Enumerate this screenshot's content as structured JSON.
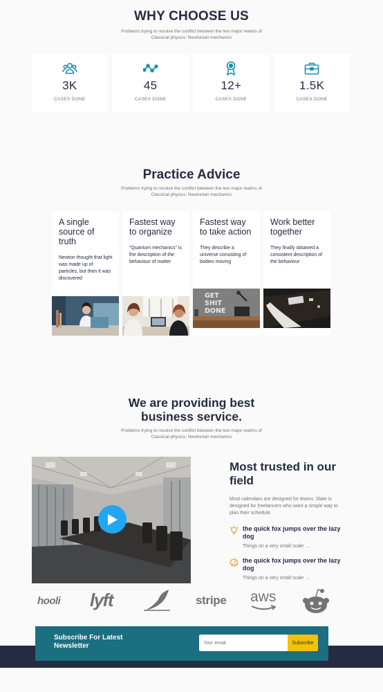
{
  "why": {
    "title": "WHY CHOOSE US",
    "subtitle": "Problems trying to resolve the conflict between the two major realms of Classical physics: Newtonian mechanics",
    "stats": [
      {
        "icon": "users-icon",
        "value": "3K",
        "label": "CASES DONE"
      },
      {
        "icon": "trend-icon",
        "value": "45",
        "label": "CASES DONE"
      },
      {
        "icon": "award-icon",
        "value": "12+",
        "label": "CASES DONE"
      },
      {
        "icon": "briefcase-icon",
        "value": "1.5K",
        "label": "CASES DONE"
      }
    ]
  },
  "practice": {
    "title": "Practice Advice",
    "subtitle": "Problems trying to resolve the conflict between the two major realms of Classical physics: Newtonian mechanics",
    "cards": [
      {
        "title": "A single source of truth",
        "text": "Newton thought that light was made up of particles, but then it was discovered"
      },
      {
        "title": "Fastest way to organize",
        "text": "“Quantum mechanics” is the description of the behaviour of matter"
      },
      {
        "title": "Fastest way to take action",
        "text": "They describe a universe consisting of bodies moving",
        "image_text": "GET SHIT DONE"
      },
      {
        "title": "Work better together",
        "text": "They finally obtained a consistent description of the behaviour"
      }
    ]
  },
  "providing": {
    "title": "We are providing best business service.",
    "subtitle": "Problems trying to resolve the conflict between the two major realms of Classical physics: Newtonian mechanics",
    "trusted_title": "Most trusted in our field",
    "trusted_text": "Most calendars are designed for teams. Slate is designed for freelancers who want a simple way to plan their schedule.",
    "features": [
      {
        "icon": "lightbulb-icon",
        "title": "the quick fox jumps over the lazy dog",
        "subtitle": "Things on a very small scale ..."
      },
      {
        "icon": "gauge-icon",
        "title": "the quick fox jumps over the lazy dog",
        "subtitle": "Things on a very small scale ..."
      }
    ],
    "accent": "#23a6f0",
    "feature_icon_color": "#e9a23b"
  },
  "logos": [
    "hooli",
    "lyft",
    "stripe",
    "aws"
  ],
  "subscribe": {
    "title": "Subscribe For Latest Newsletter",
    "placeholder": "Your email",
    "button": "Subscribe"
  },
  "colors": {
    "primary_text": "#252b42",
    "secondary_text": "#737373",
    "teal": "#1b6f80",
    "yellow": "#f3c10a",
    "icon_teal": "#1b90a8"
  }
}
